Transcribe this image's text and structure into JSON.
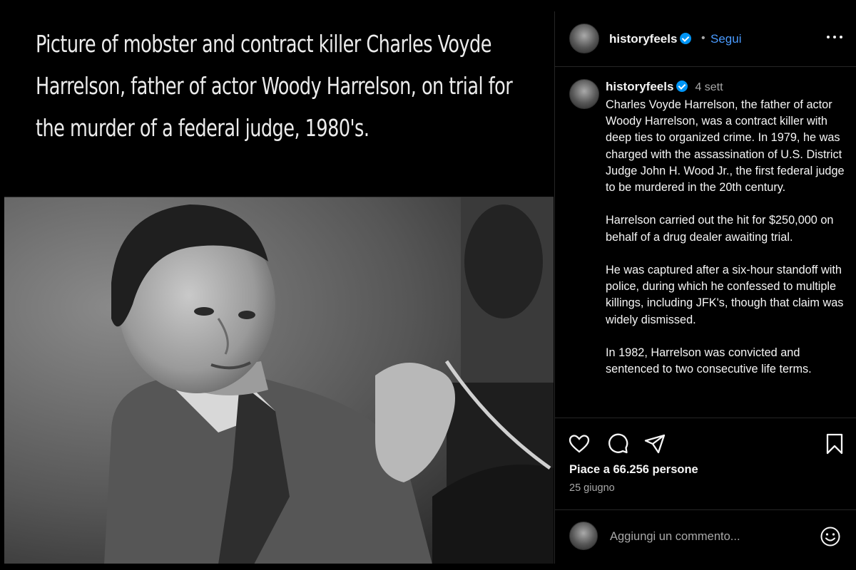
{
  "post": {
    "media_headline": "Picture of mobster and contract killer Charles Voyde Harrelson, father of actor Woody Harrelson, on trial for the murder of a federal judge, 1980's."
  },
  "header": {
    "username": "historyfeels",
    "separator": "•",
    "follow_label": "Segui"
  },
  "caption": {
    "username": "historyfeels",
    "time": "4 sett",
    "paragraphs": [
      "Charles Voyde Harrelson, the father of actor Woody Harrelson, was a contract killer with deep ties to organized crime. In 1979, he was charged with the assassination of U.S. District Judge John H. Wood Jr., the first federal judge to be murdered in the 20th century.",
      "Harrelson carried out the hit for $250,000 on behalf of a drug dealer awaiting trial.",
      "He was captured after a six-hour standoff with police, during which he confessed to multiple killings, including JFK's, though that claim was widely dismissed.",
      "In 1982, Harrelson was convicted and sentenced to two consecutive life terms."
    ]
  },
  "actions": {
    "likes": "Piace a 66.256 persone",
    "date": "25 giugno"
  },
  "add_comment": {
    "placeholder": "Aggiungi un commento..."
  },
  "colors": {
    "background": "#000000",
    "accent": "#4a9bff",
    "verified": "#0095f6",
    "muted": "#a8a8a8"
  },
  "icons": [
    "more-icon",
    "verified-icon",
    "heart-icon",
    "comment-icon",
    "share-icon",
    "bookmark-icon",
    "emoji-icon"
  ]
}
